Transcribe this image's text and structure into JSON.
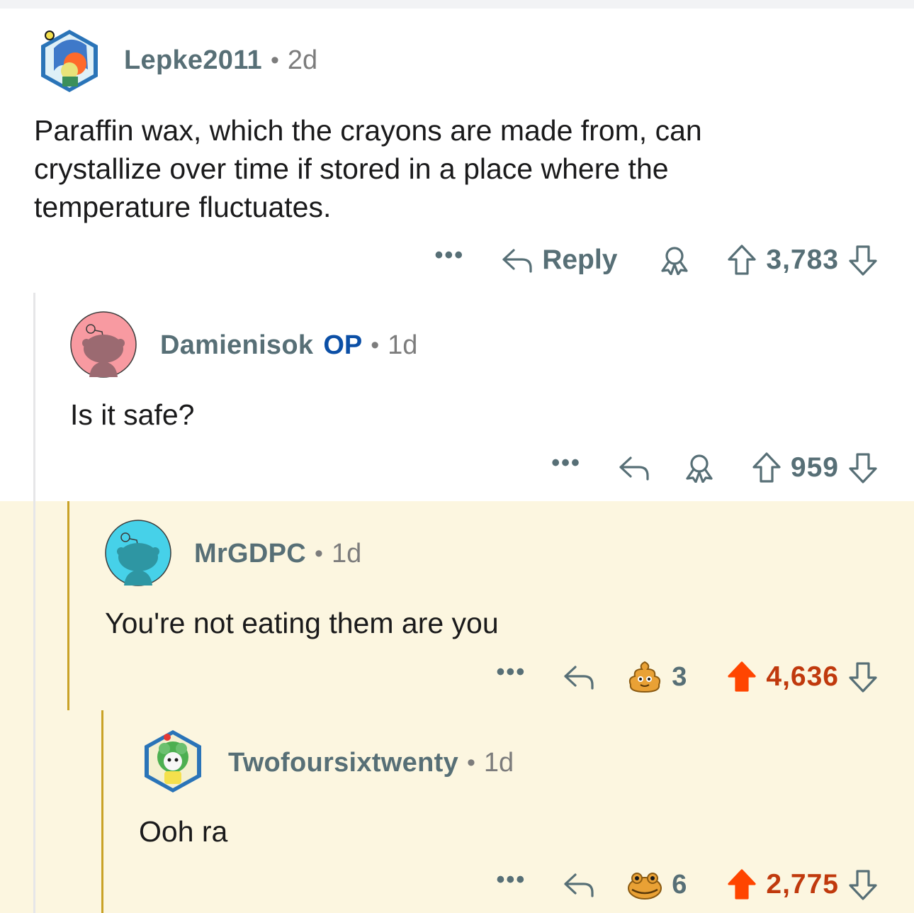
{
  "comments": [
    {
      "username": "Lepke2011",
      "op": "",
      "age": "2d",
      "body": "Paraffin wax, which the crayons are made from, can crystallize over time if stored in a place where the temperature fluctuates.",
      "reply_label": "Reply",
      "score": "3,783",
      "award_count": "",
      "upvoted": false
    },
    {
      "username": "Damienisok",
      "op": "OP",
      "age": "1d",
      "body": "Is it safe?",
      "reply_label": "",
      "score": "959",
      "award_count": "",
      "upvoted": false
    },
    {
      "username": "MrGDPC",
      "op": "",
      "age": "1d",
      "body": "You're not eating them are you",
      "reply_label": "",
      "score": "4,636",
      "award_count": "3",
      "upvoted": true
    },
    {
      "username": "Twofoursixtwenty",
      "op": "",
      "age": "1d",
      "body": "Ooh ra",
      "reply_label": "",
      "score": "2,775",
      "award_count": "6",
      "upvoted": true
    }
  ],
  "separator": "•",
  "more_label": "•••",
  "icons": {
    "more": "more-icon",
    "reply": "reply-icon",
    "award": "award-icon",
    "upvote": "upvote-icon",
    "downvote": "downvote-icon",
    "poop_award": "poop-award-icon",
    "toad_award": "toad-award-icon"
  },
  "colors": {
    "highlight_bg": "#fcf6e0",
    "thread_line": "#c9a227",
    "upvoted": "#ff4500",
    "upvoted_score": "#c0390d",
    "op": "#0b4fa6",
    "meta": "#576f76"
  }
}
